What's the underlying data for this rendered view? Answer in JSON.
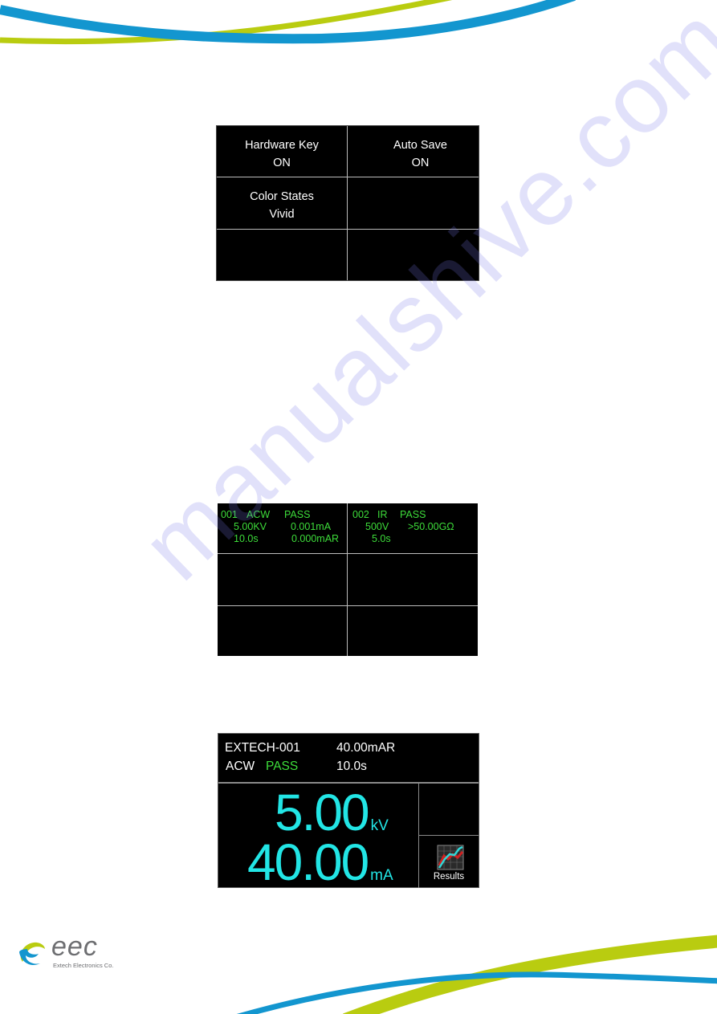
{
  "watermark": "manualshive.com",
  "brand": {
    "logo_text": "eec",
    "company": "Extech Electronics Co.",
    "colors": {
      "blue": "#1396cf",
      "green": "#b9cc10",
      "gray": "#6d6e71"
    }
  },
  "settings_screen": {
    "cells": [
      {
        "title": "Hardware Key",
        "value": "ON"
      },
      {
        "title": "Auto Save",
        "value": "ON"
      },
      {
        "title": "Color States",
        "value": "Vivid"
      },
      {
        "title": "",
        "value": ""
      },
      {
        "title": "",
        "value": ""
      },
      {
        "title": "",
        "value": ""
      }
    ]
  },
  "results_screen": {
    "text_color": "#3ddc3a",
    "cells": [
      {
        "step": "001",
        "test": "ACW",
        "status": "PASS",
        "voltage": "5.00KV",
        "current": "0.001mA",
        "time": "10.0s",
        "real_current": "0.000mAR"
      },
      {
        "step": "002",
        "test": "IR",
        "status": "PASS",
        "voltage": "500V",
        "resistance": ">50.00GΩ",
        "time": "5.0s"
      }
    ]
  },
  "test_screen": {
    "file_name": "EXTECH-001",
    "test_type": "ACW",
    "status": "PASS",
    "real_current": "40.00mAR",
    "dwell_time": "10.0s",
    "voltage_value": "5.00",
    "voltage_unit": "kV",
    "current_value": "40.00",
    "current_unit": "mA",
    "results_button": "Results",
    "results_icon": "chart-icon",
    "value_color": "#22e5e5"
  }
}
